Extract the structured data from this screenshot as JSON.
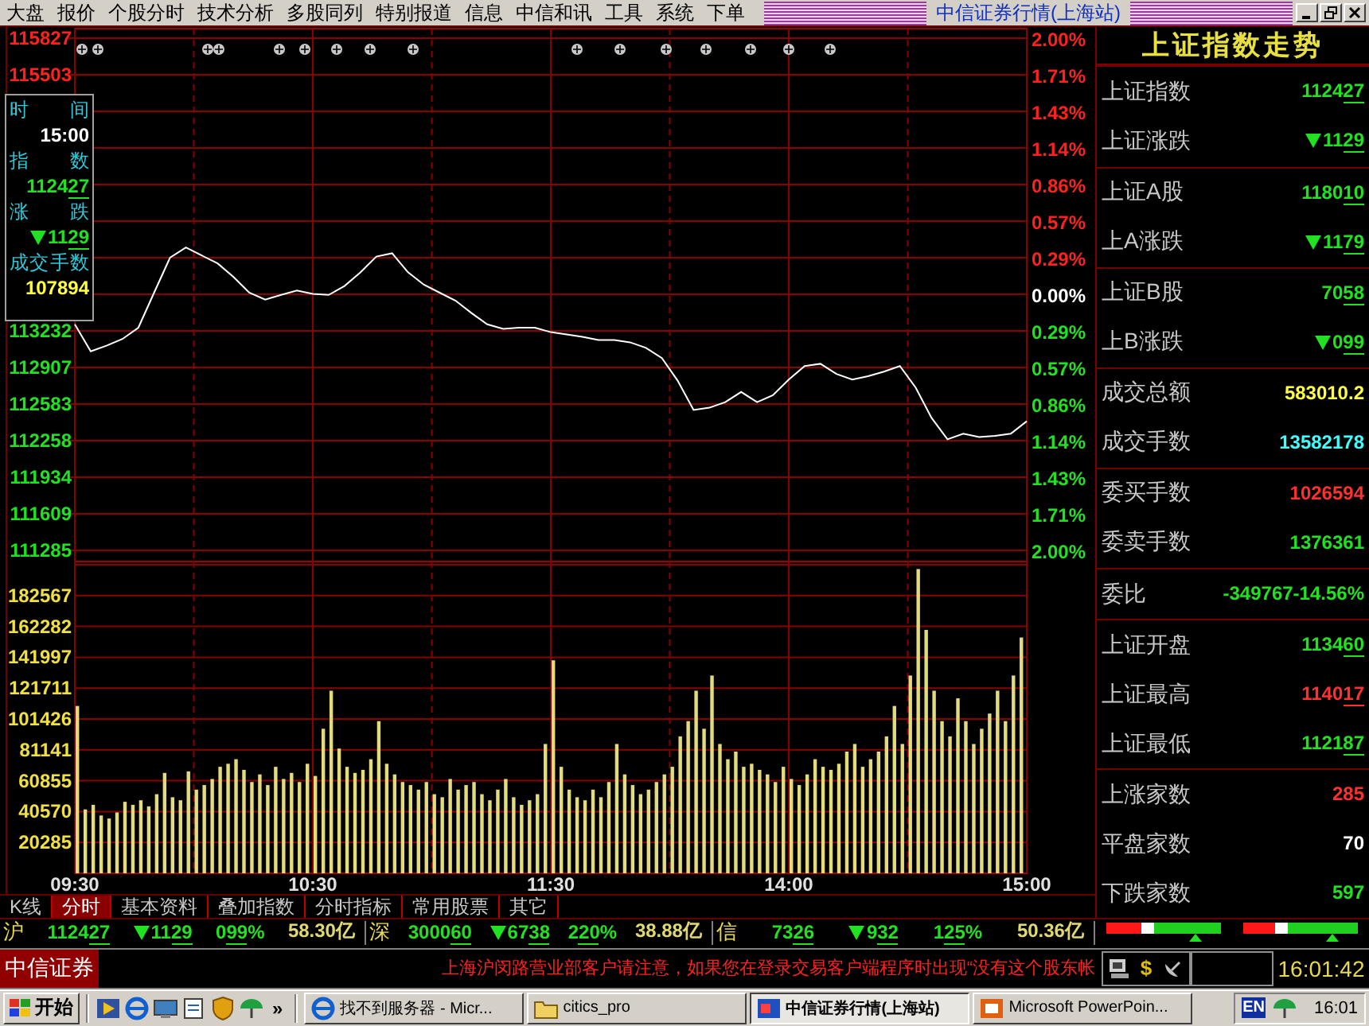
{
  "menu": [
    "大盘",
    "报价",
    "个股分时",
    "技术分析",
    "多股同列",
    "特别报道",
    "信息",
    "中信和讯",
    "工具",
    "系统",
    "下单"
  ],
  "window": {
    "title": "中信证券行情(上海站)"
  },
  "price_chart": {
    "chart_data": {
      "type": "line",
      "grid": true,
      "ylim": [
        111285,
        115827
      ],
      "series": [
        {
          "color": "#ffffff",
          "values": [
            113290,
            113050,
            113100,
            113160,
            113260,
            113570,
            113880,
            113970,
            113900,
            113830,
            113710,
            113570,
            113510,
            113550,
            113590,
            113560,
            113550,
            113630,
            113750,
            113890,
            113920,
            113750,
            113640,
            113570,
            113500,
            113390,
            113290,
            113250,
            113260,
            113260,
            113220,
            113200,
            113180,
            113150,
            113150,
            113130,
            113080,
            112990,
            112790,
            112530,
            112550,
            112600,
            112690,
            112600,
            112660,
            112800,
            112920,
            112940,
            112850,
            112800,
            112830,
            112870,
            112920,
            112730,
            112460,
            112270,
            112320,
            112290,
            112300,
            112320,
            112430
          ]
        }
      ],
      "yticks": [
        {
          "value": 115827,
          "label": "115827"
        },
        {
          "value": 115503,
          "label": "115503"
        },
        {
          "value": 113232,
          "label": "113232"
        },
        {
          "value": 112907,
          "label": "112907"
        },
        {
          "value": 112583,
          "label": "112583"
        },
        {
          "value": 112258,
          "label": "112258"
        },
        {
          "value": 111934,
          "label": "111934"
        },
        {
          "value": 111609,
          "label": "111609"
        },
        {
          "value": 111285,
          "label": "111285"
        }
      ]
    },
    "percent_axis": [
      "2.00%",
      "1.71%",
      "1.43%",
      "1.14%",
      "0.86%",
      "0.57%",
      "0.29%",
      "0.00%",
      "0.29%",
      "0.57%",
      "0.86%",
      "1.14%",
      "1.43%",
      "1.71%",
      "2.00%"
    ],
    "info_box": [
      {
        "label": "时 间",
        "value": {
          "value": "15:00",
          "color": "#ffffff"
        }
      },
      {
        "label": "指 数",
        "value": {
          "value": "112427",
          "underlined": true,
          "color": "#22e022"
        }
      },
      {
        "label": "涨 跌",
        "value": {
          "value": "1129",
          "underlined": true,
          "trend_down": true,
          "color": "#22e022"
        }
      },
      {
        "label": "成交手数",
        "value": {
          "value": "107894",
          "color": "#ffff40"
        }
      }
    ]
  },
  "volume_chart": {
    "chart_data": {
      "type": "bar",
      "grid": true,
      "ylim": [
        0,
        202852
      ],
      "categories": [
        "09:30",
        null,
        null,
        null,
        null,
        null,
        null,
        null,
        null,
        null,
        null,
        null,
        null,
        null,
        null,
        null,
        null,
        null,
        null,
        null,
        null,
        null,
        null,
        null,
        null,
        null,
        null,
        null,
        null,
        null,
        "10:30",
        null,
        null,
        null,
        null,
        null,
        null,
        null,
        null,
        null,
        null,
        null,
        null,
        null,
        null,
        null,
        null,
        null,
        null,
        null,
        null,
        null,
        null,
        null,
        null,
        null,
        null,
        null,
        null,
        null,
        "11:30",
        null,
        null,
        null,
        null,
        null,
        null,
        null,
        null,
        null,
        null,
        null,
        null,
        null,
        null,
        null,
        null,
        null,
        null,
        null,
        null,
        null,
        null,
        null,
        null,
        null,
        null,
        null,
        null,
        null,
        "14:00",
        null,
        null,
        null,
        null,
        null,
        null,
        null,
        null,
        null,
        null,
        null,
        null,
        null,
        null,
        null,
        null,
        null,
        null,
        null,
        null,
        null,
        null,
        null,
        null,
        null,
        null,
        null,
        null,
        null,
        "15:00"
      ],
      "values": [
        110000,
        42000,
        45000,
        38000,
        36000,
        40000,
        47000,
        45000,
        48000,
        44000,
        52000,
        66000,
        50000,
        48000,
        67000,
        55000,
        58000,
        62000,
        70000,
        72000,
        75000,
        68000,
        60000,
        65000,
        58000,
        70000,
        62000,
        66000,
        60000,
        72000,
        64000,
        95000,
        120000,
        82000,
        70000,
        66000,
        68000,
        75000,
        100000,
        72000,
        65000,
        60000,
        58000,
        55000,
        60000,
        52000,
        50000,
        62000,
        55000,
        58000,
        60000,
        52000,
        48000,
        55000,
        62000,
        50000,
        45000,
        48000,
        52000,
        85000,
        140000,
        70000,
        55000,
        50000,
        48000,
        55000,
        50000,
        60000,
        85000,
        65000,
        58000,
        52000,
        55000,
        60000,
        65000,
        70000,
        90000,
        100000,
        120000,
        95000,
        130000,
        85000,
        75000,
        80000,
        70000,
        72000,
        68000,
        65000,
        60000,
        70000,
        62000,
        58000,
        65000,
        75000,
        70000,
        68000,
        72000,
        80000,
        85000,
        70000,
        75000,
        80000,
        90000,
        110000,
        85000,
        130000,
        200000,
        160000,
        120000,
        100000,
        90000,
        115000,
        100000,
        85000,
        95000,
        105000,
        120000,
        100000,
        130000,
        155000,
        null
      ],
      "yticks": [
        {
          "value": 20285,
          "label": "20285"
        },
        {
          "value": 40570,
          "label": "40570"
        },
        {
          "value": 60855,
          "label": "60855"
        },
        {
          "value": 81141,
          "label": "81141"
        },
        {
          "value": 101426,
          "label": "101426"
        },
        {
          "value": 121711,
          "label": "121711"
        },
        {
          "value": 141997,
          "label": "141997"
        },
        {
          "value": 162282,
          "label": "162282"
        },
        {
          "value": 182567,
          "label": "182567"
        }
      ]
    }
  },
  "tabs": [
    {
      "label": "K线",
      "selected": false
    },
    {
      "label": "分时",
      "selected": true
    },
    {
      "label": "基本资料",
      "selected": false
    },
    {
      "label": "叠加指数",
      "selected": false
    },
    {
      "label": "分时指标",
      "selected": false
    },
    {
      "label": "常用股票",
      "selected": false
    },
    {
      "label": "其它",
      "selected": false
    }
  ],
  "panel": {
    "title": "上证指数走势",
    "groups": [
      {
        "rows": [
          {
            "label": "上证指数",
            "value": {
              "value": "112427",
              "underlined": true,
              "color": "#22e022"
            }
          },
          {
            "label": "上证涨跌",
            "value": {
              "value": "1129",
              "underlined": true,
              "trend_down": true,
              "color": "#22e022"
            }
          }
        ]
      },
      {
        "rows": [
          {
            "label": "上证A股",
            "value": {
              "value": "118010",
              "underlined": true,
              "color": "#22e022"
            }
          },
          {
            "label": "上A涨跌",
            "value": {
              "value": "1179",
              "underlined": true,
              "trend_down": true,
              "color": "#22e022"
            }
          }
        ]
      },
      {
        "rows": [
          {
            "label": "上证B股",
            "value": {
              "value": "7058",
              "underlined": true,
              "color": "#22e022"
            }
          },
          {
            "label": "上B涨跌",
            "value": {
              "value": "099",
              "underlined": true,
              "trend_down": true,
              "color": "#22e022"
            }
          }
        ]
      },
      {
        "rows": [
          {
            "label": "成交总额",
            "value": {
              "value": "583010.2",
              "color": "#ffff40"
            }
          },
          {
            "label": "成交手数",
            "value": {
              "value": "13582178",
              "color": "#40ffff"
            }
          }
        ]
      },
      {
        "rows": [
          {
            "label": "委买手数",
            "value": {
              "value": "1026594",
              "color": "#ff3030"
            }
          },
          {
            "label": "委卖手数",
            "value": {
              "value": "1376361",
              "color": "#22e022"
            }
          }
        ]
      },
      {
        "rows": [
          {
            "label": "委比",
            "value": {
              "value": "-349767-14.56%",
              "color": "#22e022"
            }
          }
        ]
      },
      {
        "rows": [
          {
            "label": "上证开盘",
            "value": {
              "value": "113460",
              "underlined": true,
              "color": "#22e022"
            }
          },
          {
            "label": "上证最高",
            "value": {
              "value": "114017",
              "underlined": true,
              "color": "#ff3030"
            }
          },
          {
            "label": "上证最低",
            "value": {
              "value": "112187",
              "underlined": true,
              "color": "#22e022"
            }
          }
        ]
      },
      {
        "rows": [
          {
            "label": "上涨家数",
            "value": {
              "value": "285",
              "color": "#ff3030"
            }
          },
          {
            "label": "平盘家数",
            "value": {
              "value": "70",
              "color": "#ffffff"
            }
          },
          {
            "label": "下跌家数",
            "value": {
              "value": "597",
              "color": "#22e022"
            }
          }
        ]
      }
    ]
  },
  "ticker": [
    {
      "name": "沪",
      "index": {
        "value": "112427",
        "underlined": true,
        "color": "#22e022"
      },
      "change": {
        "value": "1129",
        "underlined": true,
        "trend_down": true,
        "color": "#22e022"
      },
      "percent": {
        "value": "099%",
        "underlined": true,
        "color": "#22e022"
      },
      "turnover": {
        "value": "58.30亿",
        "color": "#e0d870"
      }
    },
    {
      "name": "深",
      "index": {
        "value": "300060",
        "underlined": true,
        "color": "#22e022"
      },
      "change": {
        "value": "6738",
        "underlined": true,
        "trend_down": true,
        "color": "#22e022"
      },
      "percent": {
        "value": "220%",
        "underlined": true,
        "color": "#22e022"
      },
      "turnover": {
        "value": "38.88亿",
        "color": "#e0d870"
      }
    },
    {
      "name": "信",
      "index": {
        "value": "7326",
        "underlined": true,
        "color": "#22e022"
      },
      "change": {
        "value": "932",
        "underlined": true,
        "trend_down": true,
        "color": "#22e022"
      },
      "percent": {
        "value": "125%",
        "underlined": true,
        "color": "#22e022"
      },
      "turnover": {
        "value": "50.36亿",
        "color": "#e0d870"
      }
    }
  ],
  "breadth_bars": [
    {
      "level": 0.3
    },
    {
      "level": 0.28
    }
  ],
  "status": {
    "brand": "中信证券",
    "message": "上海沪闵路营业部客户请注意，如果您在登录交易客户端程序时出现“没有这个股东帐",
    "symbol": "$",
    "clock": "16:01:42"
  },
  "taskbar": {
    "start": "开始",
    "more": "»",
    "tasks": [
      {
        "label": "找不到服务器 - Micr...",
        "kind": "browser",
        "selected": false
      },
      {
        "label": "citics_pro",
        "kind": "folder",
        "selected": false
      },
      {
        "label": "中信证券行情(上海站)",
        "kind": "app",
        "selected": true
      },
      {
        "label": "Microsoft PowerPoin...",
        "kind": "slides",
        "selected": false
      }
    ],
    "lang": "EN",
    "clock": "16:01"
  }
}
